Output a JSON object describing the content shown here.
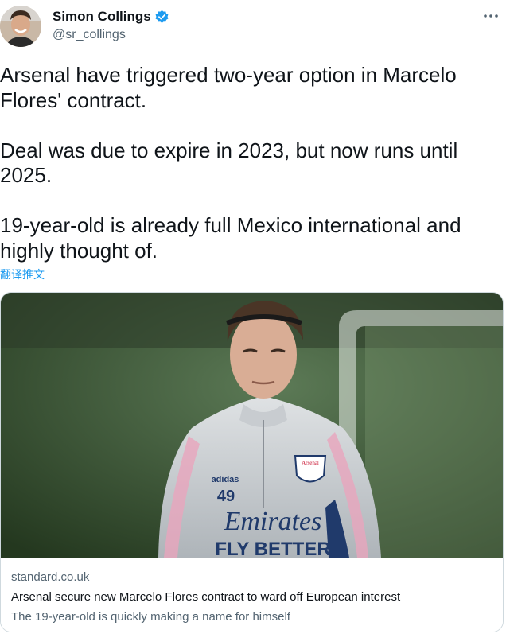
{
  "author": {
    "display_name": "Simon Collings",
    "handle": "@sr_collings",
    "verified": true,
    "avatar_icon": "profile-photo"
  },
  "tweet": {
    "text": "Arsenal have triggered two-year option in Marcelo\nFlores' contract.\n\nDeal was due to expire in 2023, but now runs until\n2025.\n\n19-year-old is already full Mexico international and\nhighly thought of.",
    "translate_label": "翻译推文"
  },
  "card": {
    "domain": "standard.co.uk",
    "title": "Arsenal secure new Marcelo Flores contract to ward off European interest",
    "description": "The 19-year-old is quickly making a name for himself",
    "image": {
      "shirt_sponsor_line1": "Emirates",
      "shirt_sponsor_line2": "FLY BETTER",
      "shirt_number": "49",
      "crest_text": "Arsenal",
      "brand_text": "adidas"
    }
  },
  "colors": {
    "link": "#1d9bf0",
    "verified_badge": "#1d9bf0",
    "secondary_text": "#536471"
  }
}
